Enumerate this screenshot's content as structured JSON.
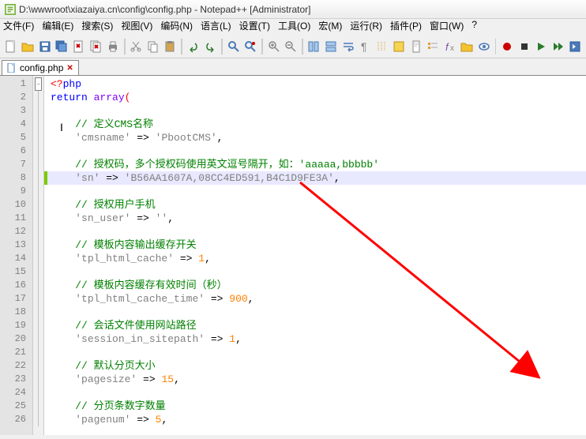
{
  "window": {
    "title": "D:\\wwwroot\\xiazaiya.cn\\config\\config.php - Notepad++ [Administrator]"
  },
  "menu": {
    "file": "文件(F)",
    "edit": "编辑(E)",
    "search": "搜索(S)",
    "view": "视图(V)",
    "encoding": "编码(N)",
    "language": "语言(L)",
    "settings": "设置(T)",
    "tools": "工具(O)",
    "macro": "宏(M)",
    "run": "运行(R)",
    "plugins": "插件(P)",
    "window": "窗口(W)",
    "help": "?"
  },
  "tab": {
    "name": "config.php",
    "close": "✕"
  },
  "icons": {
    "new": "📄",
    "open": "📂",
    "save": "💾",
    "saveall": "🗎",
    "close": "✖",
    "closeall": "⊗",
    "print": "🖨",
    "cut": "✂",
    "copy": "📋",
    "paste": "📄",
    "undo": "↶",
    "redo": "↷",
    "find": "🔍",
    "replace": "🔁",
    "zoomin": "🔎+",
    "zoomout": "🔎-",
    "wrap": "↩",
    "allchars": "¶",
    "indent": "⇥",
    "folder": "📁",
    "monitor": "👁",
    "record": "⏺",
    "play": "▶",
    "playmulti": "⏭",
    "savemacro": "💿"
  },
  "code": {
    "lines": [
      {
        "n": "1",
        "change": false,
        "html": "<span class='br'>&lt;?</span><span class='kw'>php</span>"
      },
      {
        "n": "2",
        "change": false,
        "html": "<span class='kw'>return</span> <span class='func'>array</span><span class='br'>(</span>"
      },
      {
        "n": "3",
        "change": false,
        "html": ""
      },
      {
        "n": "4",
        "change": false,
        "html": "    <span class='cm'>// 定义CMS名称</span>"
      },
      {
        "n": "5",
        "change": false,
        "html": "    <span class='str'>'cmsname'</span> =&gt; <span class='str'>'PbootCMS'</span>,"
      },
      {
        "n": "6",
        "change": false,
        "html": ""
      },
      {
        "n": "7",
        "change": false,
        "html": "    <span class='cm'>// 授权码，多个授权码使用英文逗号隔开，如：'aaaaa,bbbbb'</span>"
      },
      {
        "n": "8",
        "change": true,
        "hl": true,
        "html": "    <span class='str'>'sn'</span> =&gt; <span class='str'>'B56AA1607A,08CC4ED591,B4C1D9FE3A'</span>,"
      },
      {
        "n": "9",
        "change": false,
        "html": ""
      },
      {
        "n": "10",
        "change": false,
        "html": "    <span class='cm'>// 授权用户手机</span>"
      },
      {
        "n": "11",
        "change": false,
        "html": "    <span class='str'>'sn_user'</span> =&gt; <span class='str'>''</span>,"
      },
      {
        "n": "12",
        "change": false,
        "html": ""
      },
      {
        "n": "13",
        "change": false,
        "html": "    <span class='cm'>// 模板内容输出缓存开关</span>"
      },
      {
        "n": "14",
        "change": false,
        "html": "    <span class='str'>'tpl_html_cache'</span> =&gt; <span class='num'>1</span>,"
      },
      {
        "n": "15",
        "change": false,
        "html": ""
      },
      {
        "n": "16",
        "change": false,
        "html": "    <span class='cm'>// 模板内容缓存有效时间（秒）</span>"
      },
      {
        "n": "17",
        "change": false,
        "html": "    <span class='str'>'tpl_html_cache_time'</span> =&gt; <span class='num'>900</span>,"
      },
      {
        "n": "18",
        "change": false,
        "html": ""
      },
      {
        "n": "19",
        "change": false,
        "html": "    <span class='cm'>// 会话文件使用网站路径</span>"
      },
      {
        "n": "20",
        "change": false,
        "html": "    <span class='str'>'session_in_sitepath'</span> =&gt; <span class='num'>1</span>,"
      },
      {
        "n": "21",
        "change": false,
        "html": ""
      },
      {
        "n": "22",
        "change": false,
        "html": "    <span class='cm'>// 默认分页大小</span>"
      },
      {
        "n": "23",
        "change": false,
        "html": "    <span class='str'>'pagesize'</span> =&gt; <span class='num'>15</span>,"
      },
      {
        "n": "24",
        "change": false,
        "html": ""
      },
      {
        "n": "25",
        "change": false,
        "html": "    <span class='cm'>// 分页条数字数量</span>"
      },
      {
        "n": "26",
        "change": false,
        "html": "    <span class='str'>'pagenum'</span> =&gt; <span class='num'>5</span>,"
      }
    ]
  }
}
